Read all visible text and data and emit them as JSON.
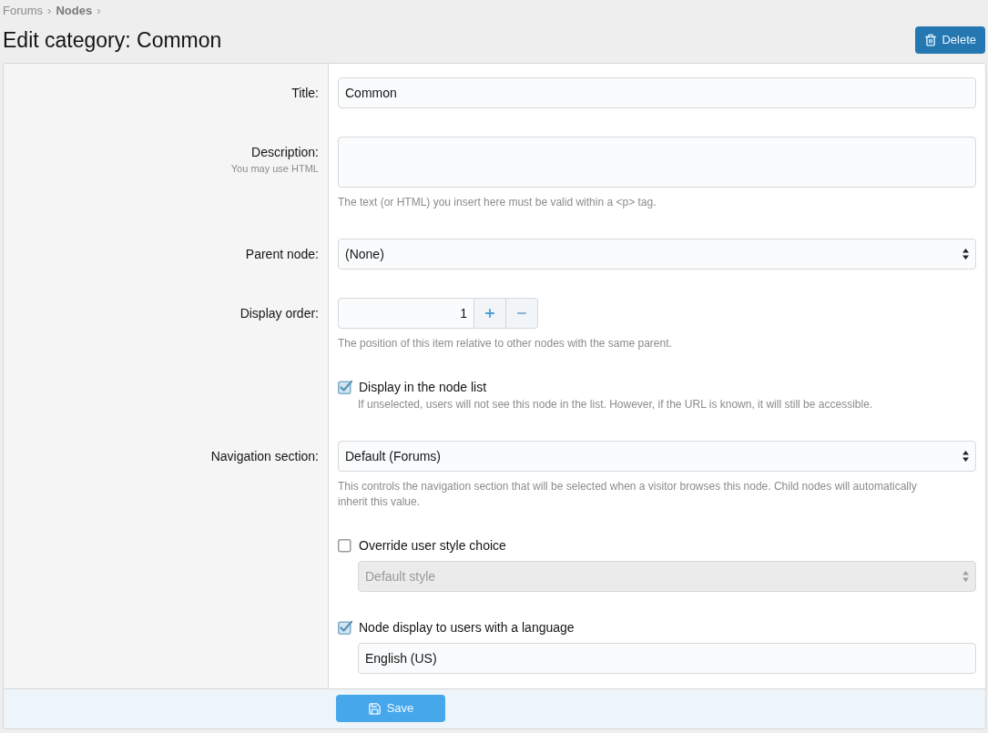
{
  "breadcrumb": [
    {
      "label": "Forums",
      "separator": "›"
    },
    {
      "label": "Nodes",
      "separator": "›"
    }
  ],
  "page_title": "Edit category: Common",
  "delete_button": {
    "label": "Delete"
  },
  "form": {
    "rows": [
      {
        "kind": "text",
        "label": "Title:",
        "value": "Common"
      },
      {
        "kind": "textarea",
        "label": "Description:",
        "label_hint": "You may use HTML",
        "explain": "The text (or HTML) you insert here must be valid within a <p> tag."
      },
      {
        "kind": "select",
        "label": "Parent node:",
        "value": "(None)"
      },
      {
        "kind": "number",
        "label": "Display order:",
        "value": "1",
        "explain": "The position of this item relative to other nodes with the same parent."
      },
      {
        "kind": "checkbox",
        "label": "Display in the node list",
        "checked": true,
        "hint": "If unselected, users will not see this node in the list. However, if the URL is known, it will still be accessible."
      },
      {
        "kind": "select",
        "label": "Navigation section:",
        "value": "Default (Forums)",
        "explain": "This controls the navigation section that will be selected when a visitor browses this node. Child nodes will automatically inherit this value."
      },
      {
        "kind": "checkbox",
        "label": "Override user style choice",
        "checked": false,
        "sub_field": {
          "kind": "select",
          "value": "Default style",
          "disabled": true
        }
      },
      {
        "kind": "checkbox",
        "label": "Node display to users with a language",
        "checked": true,
        "sub_field": {
          "kind": "field",
          "value": "English (US)",
          "disabled": false
        }
      }
    ]
  },
  "save_button": {
    "label": "Save"
  }
}
